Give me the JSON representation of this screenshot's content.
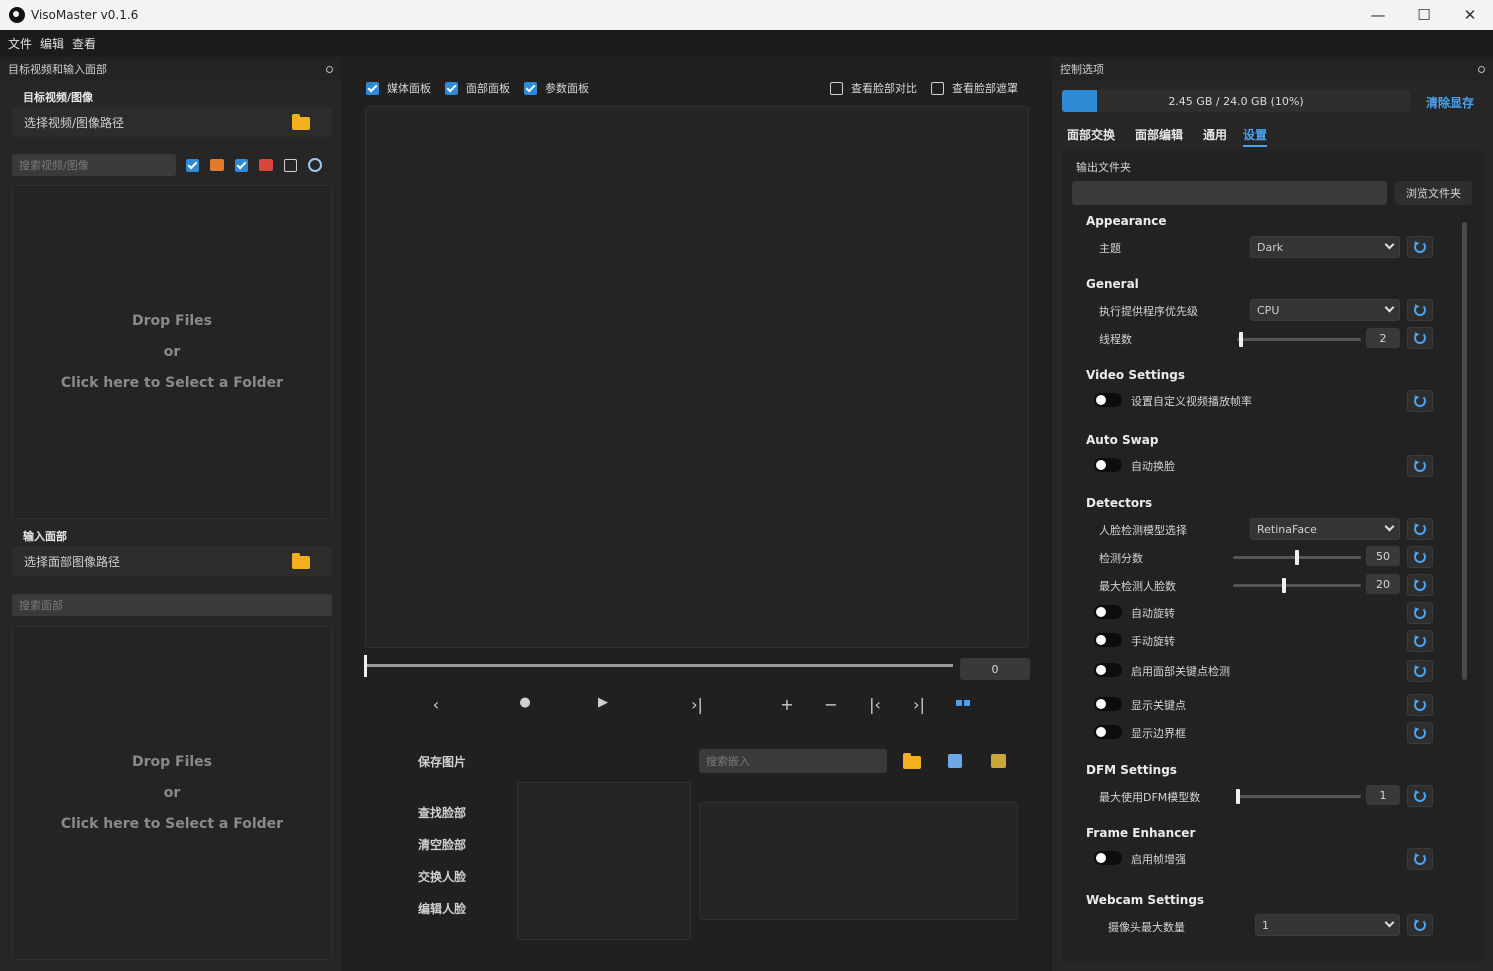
{
  "window": {
    "title": "VisoMaster v0.1.6",
    "minimize": "—",
    "maximize": "☐",
    "close": "✕"
  },
  "menu": [
    "文件",
    "编辑",
    "查看"
  ],
  "left": {
    "header": "目标视频和输入面部",
    "target_title": "目标视频/图像",
    "target_path": "选择视频/图像路径",
    "target_search_placeholder": "搜索视频/图像",
    "drop": {
      "line1": "Drop Files",
      "line2": "or",
      "line3": "Click here to Select a Folder"
    },
    "face_title": "输入面部",
    "face_path": "选择面部图像路径",
    "face_search_placeholder": "搜索面部"
  },
  "center": {
    "checks": [
      {
        "label": "媒体面板",
        "checked": true
      },
      {
        "label": "面部面板",
        "checked": true
      },
      {
        "label": "参数面板",
        "checked": true
      }
    ],
    "right_checks": [
      {
        "label": "查看脸部对比",
        "checked": false
      },
      {
        "label": "查看脸部遮罩",
        "checked": false
      }
    ],
    "frame_value": "0",
    "save_image": "保存图片",
    "embed_search_placeholder": "搜索嵌入",
    "actions": [
      "查找脸部",
      "清空脸部",
      "交换人脸",
      "编辑人脸"
    ]
  },
  "right": {
    "header": "控制选项",
    "vram_text": "2.45 GB / 24.0 GB (10%)",
    "vram_fraction": 0.1,
    "clear_vram": "清除显存",
    "tabs": [
      "面部交换",
      "面部编辑",
      "通用",
      "设置"
    ],
    "active_tab": 3,
    "output_folder_label": "输出文件夹",
    "browse_folder": "浏览文件夹",
    "groups": {
      "appearance": "Appearance",
      "general": "General",
      "video": "Video Settings",
      "autoswap": "Auto Swap",
      "detectors": "Detectors",
      "dfm": "DFM Settings",
      "frame": "Frame Enhancer",
      "webcam": "Webcam Settings"
    },
    "theme_label": "主题",
    "theme_value": "Dark",
    "provider_label": "执行提供程序优先级",
    "provider_value": "CPU",
    "threads_label": "线程数",
    "threads_value": "2",
    "custom_fps_label": "设置自定义视频播放帧率",
    "autoswap_label": "自动换脸",
    "detect_model_label": "人脸检测模型选择",
    "detect_model_value": "RetinaFace",
    "detect_score_label": "检测分数",
    "detect_score_value": "50",
    "max_faces_label": "最大检测人脸数",
    "max_faces_value": "20",
    "auto_rotate_label": "自动旋转",
    "manual_rotate_label": "手动旋转",
    "landmark_label": "启用面部关键点检测",
    "show_landmarks_label": "显示关键点",
    "show_bbox_label": "显示边界框",
    "dfm_label": "最大使用DFM模型数",
    "dfm_value": "1",
    "frame_enh_label": "启用帧增强",
    "webcam_label": "摄像头最大数量",
    "webcam_value": "1"
  }
}
